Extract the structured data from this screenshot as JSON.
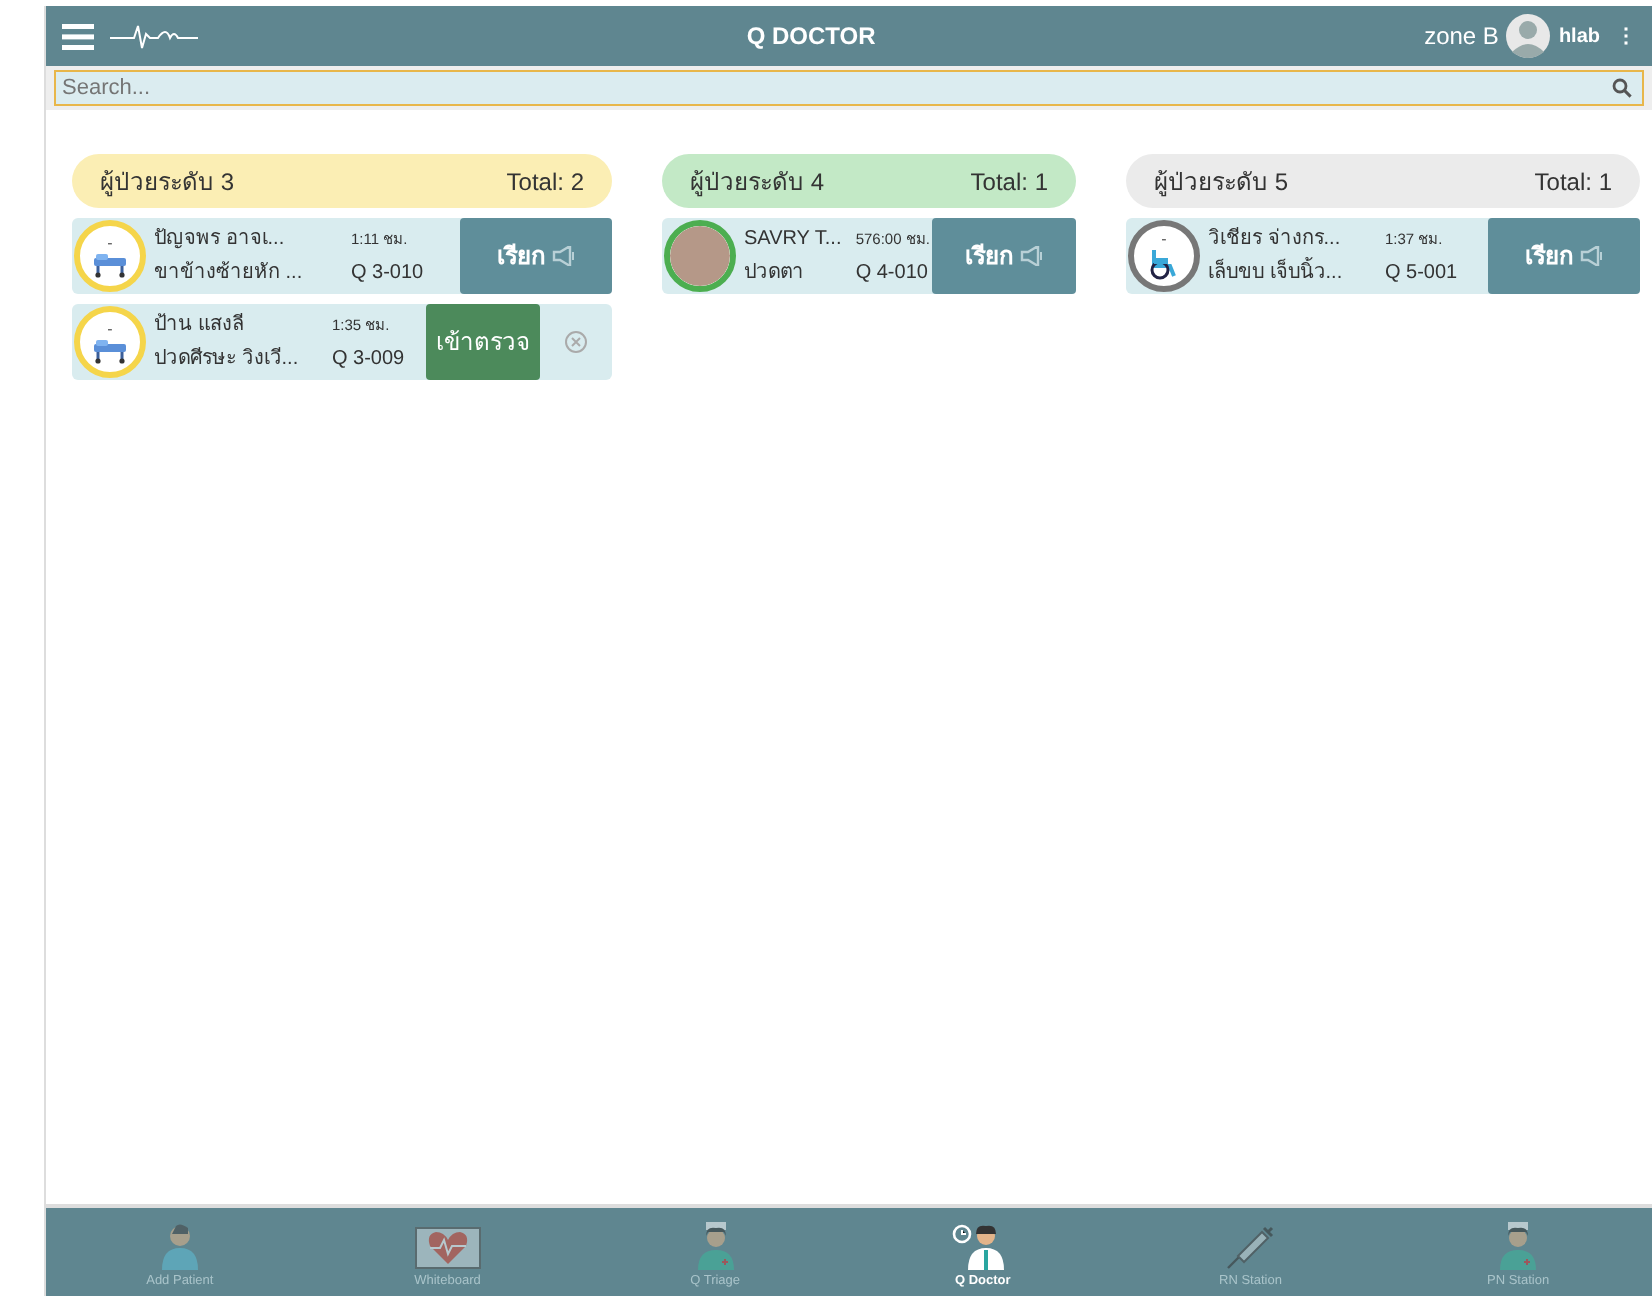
{
  "header": {
    "title": "Q DOCTOR",
    "zone": "zone B",
    "user": "hlab",
    "menu_glyph": "⋮"
  },
  "search": {
    "placeholder": "Search..."
  },
  "columns": [
    {
      "title": "ผู้ป่วยระดับ 3",
      "total": "Total: 2",
      "color": "#fbeeb4",
      "patients": [
        {
          "avatar": {
            "kind": "stretcher",
            "mark": "-",
            "color": "#f5d54a"
          },
          "name": "ปัญจพร อาจเ...",
          "time": "1:11 ชม.",
          "complaint": "ขาข้างซ้ายหัก ...",
          "queue": "Q 3-010",
          "action": {
            "kind": "call",
            "label": "เรียก"
          }
        },
        {
          "avatar": {
            "kind": "stretcher",
            "mark": "-",
            "color": "#f5d54a"
          },
          "name": "ป้าน แสงลี",
          "time": "1:35 ชม.",
          "complaint": "ปวดศีรษะ วิงเวี...",
          "queue": "Q 3-009",
          "action": {
            "kind": "examine",
            "label": "เข้าตรวจ"
          }
        }
      ]
    },
    {
      "title": "ผู้ป่วยระดับ 4",
      "total": "Total: 1",
      "color": "#c3e9c6",
      "patients": [
        {
          "avatar": {
            "kind": "photo",
            "color": "#4cae50"
          },
          "name": "SAVRY T...",
          "time": "576:00 ชม.",
          "complaint": "ปวดตา",
          "queue": "Q 4-010",
          "action": {
            "kind": "call",
            "label": "เรียก"
          }
        }
      ]
    },
    {
      "title": "ผู้ป่วยระดับ 5",
      "total": "Total: 1",
      "color": "#ebebeb",
      "patients": [
        {
          "avatar": {
            "kind": "wheelchair",
            "mark": "-",
            "color": "#777777"
          },
          "name": "วิเชียร จ่างกร...",
          "time": "1:37 ชม.",
          "complaint": "เล็บขบ เจ็บนิ้ว...",
          "queue": "Q 5-001",
          "action": {
            "kind": "call",
            "label": "เรียก"
          }
        }
      ]
    }
  ],
  "bottom_nav": [
    {
      "label": "Add Patient",
      "kind": "person",
      "selected": false
    },
    {
      "label": "Whiteboard",
      "kind": "heart",
      "selected": false
    },
    {
      "label": "Q Triage",
      "kind": "nurse",
      "selected": false
    },
    {
      "label": "Q Doctor",
      "kind": "doctor",
      "selected": true
    },
    {
      "label": "RN Station",
      "kind": "syringe",
      "selected": false
    },
    {
      "label": "PN Station",
      "kind": "nurse",
      "selected": false
    }
  ]
}
